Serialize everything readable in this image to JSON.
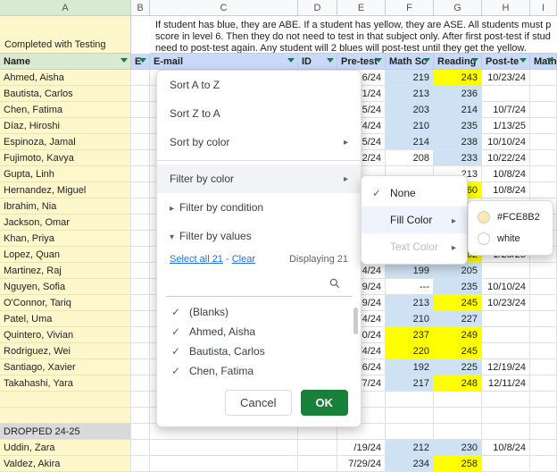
{
  "columns": [
    "A",
    "B",
    "C",
    "D",
    "E",
    "F",
    "G",
    "H",
    "I"
  ],
  "a1_label": "Completed with Testing",
  "note": "If student has blue, they are ABE. If a student has yellow, they are ASE. All students must p score in level 6. Then they do not need to test in that subject only. After first post-test if stud need to post-test again. Any student will 2 blues will post-test until they get the yellow.",
  "headers": {
    "name": "Name",
    "email": "E-mail",
    "id": "ID",
    "pretest": "Pre-test",
    "math_sc": "Math Sc",
    "reading": "Reading",
    "postte": "Post-te",
    "math_s2": "Math S"
  },
  "rows": [
    {
      "name": "Ahmed, Aisha",
      "pre": "/16/24",
      "math": "219",
      "mbg": "blue",
      "read": "243",
      "rbg": "yellow",
      "post": "10/23/24"
    },
    {
      "name": "Bautista, Carlos",
      "pre": "0/1/24",
      "math": "213",
      "mbg": "blue",
      "read": "236",
      "rbg": "blue",
      "post": ""
    },
    {
      "name": "Chen, Fatima",
      "pre": "/15/24",
      "math": "203",
      "mbg": "blue",
      "read": "214",
      "rbg": "blue",
      "post": "10/7/24"
    },
    {
      "name": "Díaz, Hiroshi",
      "pre": "1/4/24",
      "math": "210",
      "mbg": "blue",
      "read": "235",
      "rbg": "blue",
      "post": "1/13/25"
    },
    {
      "name": "Espinoza, Jamal",
      "pre": "/15/24",
      "math": "214",
      "mbg": "blue",
      "read": "238",
      "rbg": "blue",
      "post": "10/10/24"
    },
    {
      "name": "Fujimoto, Kavya",
      "pre": "/12/24",
      "math": "208",
      "mbg": "",
      "read": "233",
      "rbg": "blue",
      "post": "10/22/24"
    },
    {
      "name": "Gupta, Linh",
      "pre": "",
      "math": "",
      "mbg": "",
      "read": "213",
      "rbg": "",
      "post": "10/8/24"
    },
    {
      "name": "Hernandez, Miguel",
      "pre": "",
      "math": "",
      "mbg": "",
      "read": "260",
      "rbg": "yellow",
      "post": "10/8/24"
    },
    {
      "name": "Ibrahim, Nia",
      "pre": "",
      "math": "",
      "mbg": "",
      "read": "",
      "rbg": "",
      "post": ""
    },
    {
      "name": "Jackson, Omar",
      "pre": "",
      "math": "",
      "mbg": "",
      "read": "",
      "rbg": "",
      "post": ""
    },
    {
      "name": "Khan, Priya",
      "pre": "",
      "math": "",
      "mbg": "",
      "read": "",
      "rbg": "",
      "post": ""
    },
    {
      "name": "Lopez, Quan",
      "pre": "1/4/24",
      "math": "231",
      "mbg": "blue",
      "read": "262",
      "rbg": "yellow",
      "post": "1/28/25"
    },
    {
      "name": "Martinez, Raj",
      "pre": "4/24",
      "math": "199",
      "mbg": "blue",
      "read": "205",
      "rbg": "blue",
      "post": ""
    },
    {
      "name": "Nguyen, Sofia",
      "pre": "/19/24",
      "math": "---",
      "mbg": "",
      "read": "235",
      "rbg": "blue",
      "post": "10/10/24"
    },
    {
      "name": "O'Connor, Tariq",
      "pre": "/29/24",
      "math": "213",
      "mbg": "blue",
      "read": "245",
      "rbg": "yellow",
      "post": "10/23/24"
    },
    {
      "name": "Patel, Uma",
      "pre": "1/4/24",
      "math": "210",
      "mbg": "blue",
      "read": "227",
      "rbg": "blue",
      "post": ""
    },
    {
      "name": "Quintero, Vivian",
      "pre": "/30/24",
      "math": "237",
      "mbg": "yellow",
      "read": "249",
      "rbg": "yellow",
      "post": ""
    },
    {
      "name": "Rodriguez, Wei",
      "pre": "1/4/24",
      "math": "220",
      "mbg": "yellow",
      "read": "245",
      "rbg": "yellow",
      "post": ""
    },
    {
      "name": "Santiago, Xavier",
      "pre": "/16/24",
      "math": "192",
      "mbg": "blue",
      "read": "225",
      "rbg": "blue",
      "post": "12/19/24"
    },
    {
      "name": "Takahashi, Yara",
      "pre": "0/7/24",
      "math": "217",
      "mbg": "blue",
      "read": "248",
      "rbg": "yellow",
      "post": "12/11/24"
    },
    {
      "name": "",
      "pre": "",
      "math": "",
      "mbg": "",
      "read": "",
      "rbg": "",
      "post": ""
    },
    {
      "name": "",
      "pre": "",
      "math": "",
      "mbg": "",
      "read": "",
      "rbg": "",
      "post": ""
    },
    {
      "name": "DROPPED 24-25",
      "dropped": true,
      "pre": "",
      "math": "",
      "mbg": "",
      "read": "",
      "rbg": "",
      "post": ""
    },
    {
      "name": "Uddin, Zara",
      "pre": "/19/24",
      "math": "212",
      "mbg": "blue",
      "read": "230",
      "rbg": "blue",
      "post": "10/8/24"
    },
    {
      "name": "Valdez, Akira",
      "pre": "7/29/24",
      "math": "234",
      "mbg": "blue",
      "read": "258",
      "rbg": "yellow",
      "post": ""
    }
  ],
  "popover": {
    "sort_az": "Sort A to Z",
    "sort_za": "Sort Z to A",
    "sort_color": "Sort by color",
    "filter_color": "Filter by color",
    "filter_condition": "Filter by condition",
    "filter_values": "Filter by values",
    "select_all": "Select all 21",
    "clear": "Clear",
    "displaying": "Displaying 21",
    "search_placeholder": "",
    "values": [
      "(Blanks)",
      "Ahmed, Aisha",
      "Bautista, Carlos",
      "Chen, Fatima"
    ],
    "cancel": "Cancel",
    "ok": "OK"
  },
  "submenu1": {
    "none": "None",
    "fill": "Fill Color",
    "text": "Text Color"
  },
  "submenu2": {
    "c1_hex": "#FCE8B2",
    "c1_label": "#FCE8B2",
    "c2_hex": "#ffffff",
    "c2_label": "white"
  }
}
